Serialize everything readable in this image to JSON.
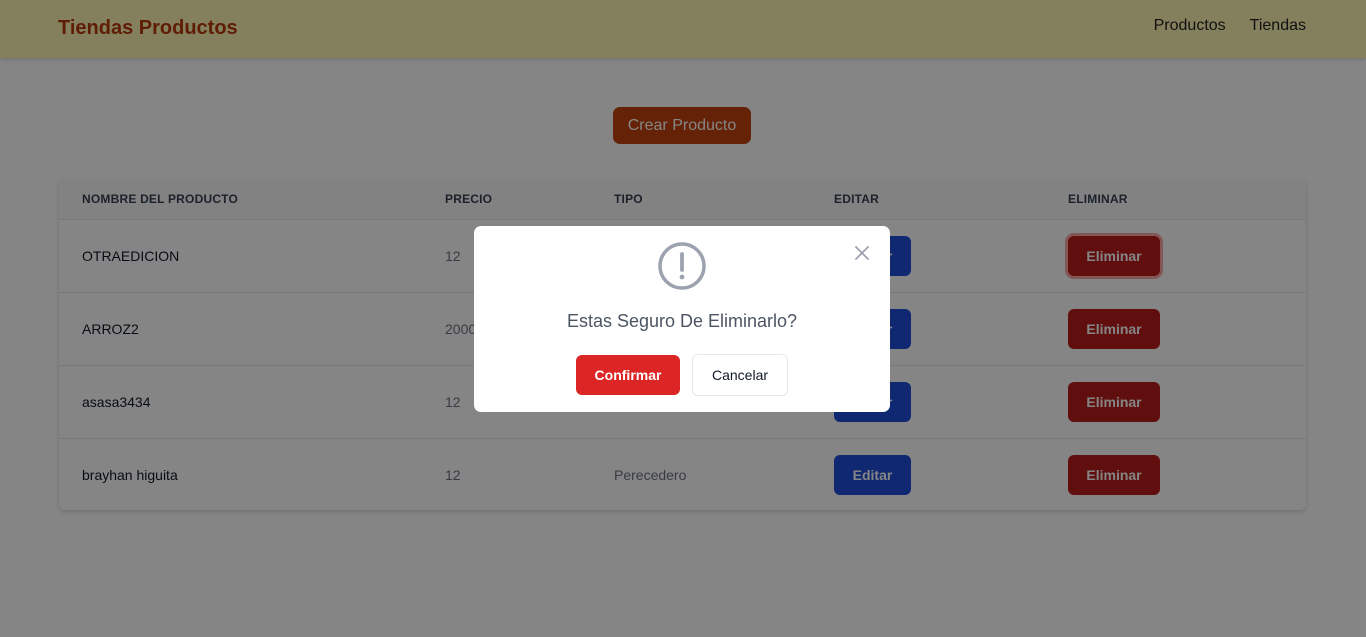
{
  "header": {
    "brand": "Tiendas Productos",
    "nav": [
      "Productos",
      "Tiendas"
    ]
  },
  "actions": {
    "create_label": "Crear Producto"
  },
  "table": {
    "columns": [
      "NOMBRE DEL PRODUCTO",
      "PRECIO",
      "TIPO",
      "EDITAR",
      "ELIMINAR"
    ],
    "rows": [
      {
        "name": "OTRAEDICION",
        "price": "12",
        "type": "",
        "edit": "Editar",
        "delete": "Eliminar"
      },
      {
        "name": "ARROZ2",
        "price": "2000",
        "type": "",
        "edit": "Editar",
        "delete": "Eliminar"
      },
      {
        "name": "asasa3434",
        "price": "12",
        "type": "",
        "edit": "Editar",
        "delete": "Eliminar"
      },
      {
        "name": "brayhan higuita",
        "price": "12",
        "type": "Perecedero",
        "edit": "Editar",
        "delete": "Eliminar"
      }
    ]
  },
  "modal": {
    "icon": "exclamation-circle-icon",
    "message": "Estas Seguro De Eliminarlo?",
    "confirm_label": "Confirmar",
    "cancel_label": "Cancelar",
    "close_icon": "close-icon"
  },
  "colors": {
    "navbar_bg": "#fdf5b2",
    "brand": "#b8390a",
    "create_button": "#c2410c",
    "edit_button": "#1d4ed8",
    "delete_button": "#b91c1c",
    "confirm_button": "#dc2626"
  }
}
